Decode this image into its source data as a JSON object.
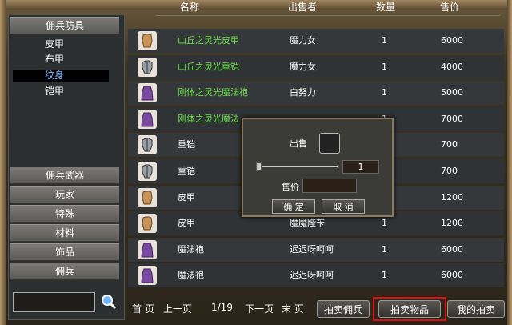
{
  "sidebar": {
    "categories": [
      {
        "label": "佣兵防具"
      },
      {
        "label": "佣兵武器"
      },
      {
        "label": "玩家"
      },
      {
        "label": "特殊"
      },
      {
        "label": "材料"
      },
      {
        "label": "饰品"
      },
      {
        "label": "佣兵"
      }
    ],
    "sub_items": [
      {
        "label": "皮甲"
      },
      {
        "label": "布甲"
      },
      {
        "label": "纹身"
      },
      {
        "label": "铠甲"
      }
    ],
    "selected_sub": "纹身"
  },
  "table": {
    "headers": {
      "name": "名称",
      "seller": "出售者",
      "qty": "数量",
      "price": "售价"
    },
    "rows": [
      {
        "name": "山丘之灵光皮甲",
        "seller": "魔力女",
        "qty": "1",
        "price": "6000",
        "name_color": "#6cde4a",
        "icon": "leather-armor-icon"
      },
      {
        "name": "山丘之灵光重铠",
        "seller": "魔力女",
        "qty": "1",
        "price": "4000",
        "name_color": "#6cde4a",
        "icon": "plate-armor-icon"
      },
      {
        "name": "刚体之灵光魔法袍",
        "seller": "白努力",
        "qty": "1",
        "price": "5000",
        "name_color": "#6cde4a",
        "icon": "magic-robe-icon"
      },
      {
        "name": "刚体之灵光魔法",
        "seller": "",
        "qty": "1",
        "price": "7000",
        "name_color": "#6cde4a",
        "icon": "magic-robe-icon"
      },
      {
        "name": "重铠",
        "seller": "",
        "qty": "",
        "price": "700",
        "name_color": "#ffffff",
        "icon": "plate-armor-icon"
      },
      {
        "name": "重铠",
        "seller": "",
        "qty": "",
        "price": "700",
        "name_color": "#ffffff",
        "icon": "plate-armor-icon"
      },
      {
        "name": "皮甲",
        "seller": "",
        "qty": "",
        "price": "1200",
        "name_color": "#ffffff",
        "icon": "leather-armor-icon"
      },
      {
        "name": "皮甲",
        "seller": "魔魔陛苄",
        "qty": "1",
        "price": "1200",
        "name_color": "#ffffff",
        "icon": "leather-armor-icon"
      },
      {
        "name": "魔法袍",
        "seller": "迟迟呀呵呵",
        "qty": "1",
        "price": "6000",
        "name_color": "#ffffff",
        "icon": "magic-robe-icon"
      },
      {
        "name": "魔法袍",
        "seller": "迟迟呀呵呵",
        "qty": "1",
        "price": "6000",
        "name_color": "#ffffff",
        "icon": "magic-robe-icon"
      }
    ]
  },
  "pager": {
    "first": "首 页",
    "prev": "上一页",
    "page": "1/19",
    "next": "下一页",
    "last": "末 页"
  },
  "bottom_buttons": {
    "auction_merc": "拍卖佣兵",
    "auction_item": "拍卖物品",
    "my_auction": "我的拍卖"
  },
  "dialog": {
    "sell_label": "出售",
    "quantity": "1",
    "price_label": "售价",
    "confirm": "确 定",
    "cancel": "取 消"
  },
  "colors": {
    "highlight_border": "#d11111",
    "green_name": "#6cde4a",
    "selected_sub": "#7fb4ff"
  }
}
